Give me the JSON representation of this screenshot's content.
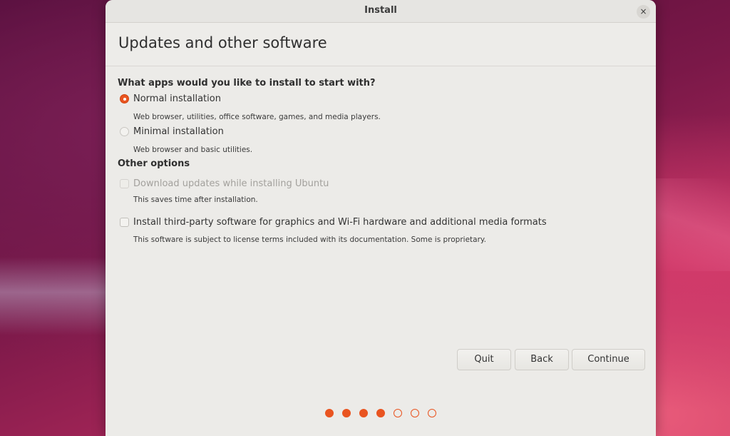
{
  "window": {
    "title": "Install",
    "close_symbol": "×"
  },
  "page": {
    "title": "Updates and other software"
  },
  "install_type": {
    "heading": "What apps would you like to install to start with?",
    "options": [
      {
        "label": "Normal installation",
        "description": "Web browser, utilities, office software, games, and media players.",
        "selected": true
      },
      {
        "label": "Minimal installation",
        "description": "Web browser and basic utilities.",
        "selected": false
      }
    ]
  },
  "other_options": {
    "heading": "Other options",
    "items": [
      {
        "label": "Download updates while installing Ubuntu",
        "description": "This saves time after installation.",
        "checked": false,
        "disabled": true
      },
      {
        "label": "Install third-party software for graphics and Wi-Fi hardware and additional media formats",
        "description": "This software is subject to license terms included with its documentation. Some is proprietary.",
        "checked": false,
        "disabled": false
      }
    ]
  },
  "buttons": {
    "quit": "Quit",
    "back": "Back",
    "continue": "Continue"
  },
  "progress": {
    "total_steps": 7,
    "completed_steps": 4
  },
  "colors": {
    "accent": "#e95420",
    "window_bg": "#ecebe8"
  }
}
